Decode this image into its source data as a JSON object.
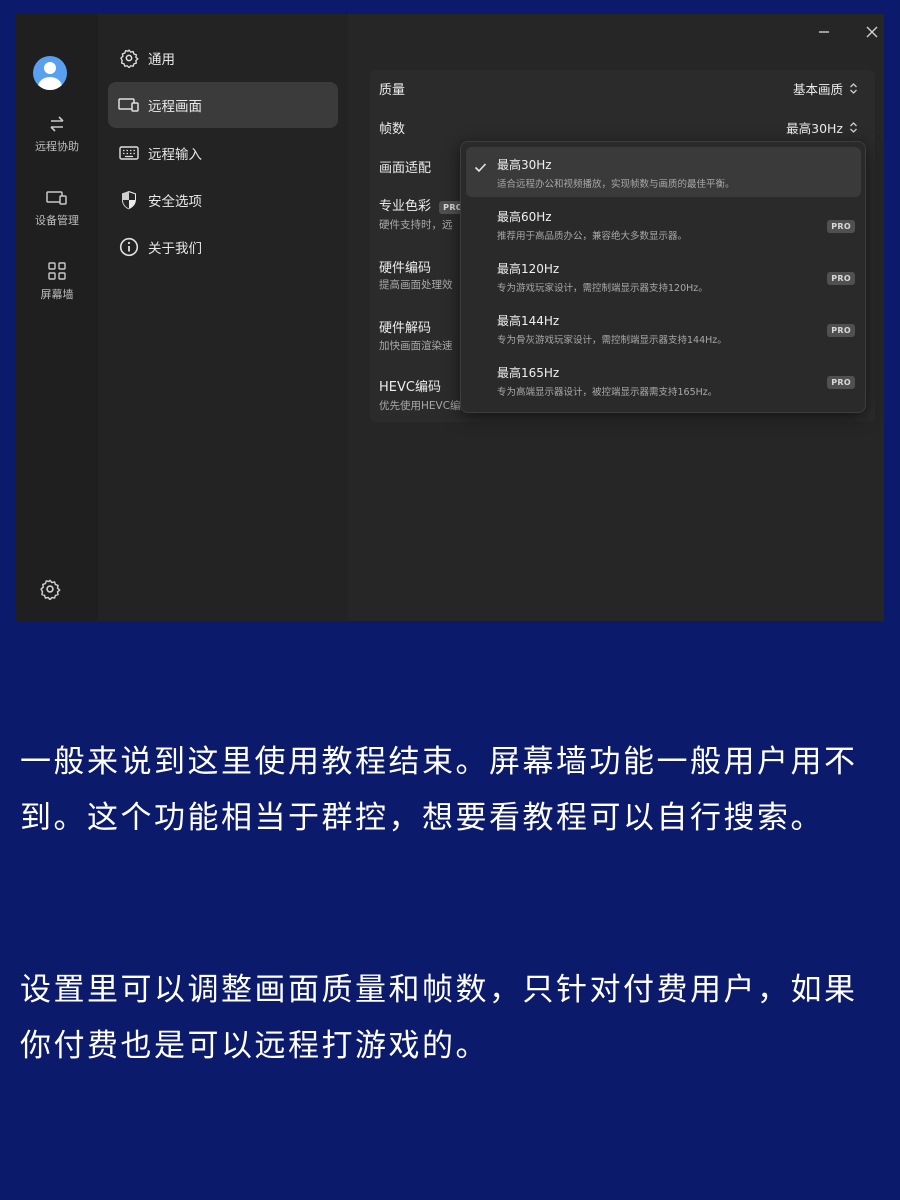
{
  "rail": {
    "items": [
      {
        "label": "远程协助",
        "icon": "swap-arrows-icon"
      },
      {
        "label": "设备管理",
        "icon": "devices-icon"
      },
      {
        "label": "屏幕墙",
        "icon": "grid-icon"
      }
    ]
  },
  "nav": {
    "items": [
      {
        "label": "通用",
        "icon": "gear-icon"
      },
      {
        "label": "远程画面",
        "icon": "devices-icon",
        "active": true
      },
      {
        "label": "远程输入",
        "icon": "keyboard-icon"
      },
      {
        "label": "安全选项",
        "icon": "shield-icon"
      },
      {
        "label": "关于我们",
        "icon": "info-icon"
      }
    ]
  },
  "settings": {
    "quality_label": "质量",
    "quality_value": "基本画质",
    "fps_label": "帧数",
    "fps_value": "最高30Hz",
    "fit_label": "画面适配",
    "color_label": "专业色彩",
    "color_sub": "硬件支持时，远",
    "hw_encode_label": "硬件编码",
    "hw_encode_sub": "提高画面处理效",
    "hw_decode_label": "硬件解码",
    "hw_decode_sub": "加快画面渲染速",
    "hevc_label": "HEVC编码",
    "hevc_sub": "优先使用HEVC编",
    "pro_badge": "PRO"
  },
  "fps_dropdown": {
    "options": [
      {
        "title": "最高30Hz",
        "desc": "适合远程办公和视频播放，实现帧数与画质的最佳平衡。",
        "selected": true,
        "pro": false
      },
      {
        "title": "最高60Hz",
        "desc": "推荐用于高品质办公，兼容绝大多数显示器。",
        "selected": false,
        "pro": true
      },
      {
        "title": "最高120Hz",
        "desc": "专为游戏玩家设计，需控制端显示器支持120Hz。",
        "selected": false,
        "pro": true
      },
      {
        "title": "最高144Hz",
        "desc": "专为骨灰游戏玩家设计，需控制端显示器支持144Hz。",
        "selected": false,
        "pro": true
      },
      {
        "title": "最高165Hz",
        "desc": "专为高端显示器设计，被控端显示器需支持165Hz。",
        "selected": false,
        "pro": true
      }
    ]
  },
  "caption": {
    "paragraph1": "一般来说到这里使用教程结束。屏幕墙功能一般用户用不到。这个功能相当于群控，想要看教程可以自行搜索。",
    "paragraph2": "设置里可以调整画面质量和帧数，只针对付费用户，如果你付费也是可以远程打游戏的。"
  },
  "colors": {
    "background": "#0b1a6b",
    "window": "#262626",
    "accent_avatar": "#5aa0f0"
  }
}
